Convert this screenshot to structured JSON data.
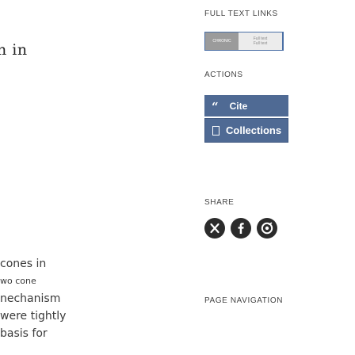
{
  "article": {
    "heading_fragment": "n in",
    "lines": [
      {
        "text": "cones in",
        "small": false
      },
      {
        "text": "wo cone",
        "small": true
      },
      {
        "text": "nechanism",
        "small": false
      },
      {
        "text": "were tightly",
        "small": false
      },
      {
        "text": "basis for",
        "small": false
      }
    ]
  },
  "sidebar": {
    "full_text_links": {
      "label": "FULL TEXT LINKS",
      "badge_left": "CHRONIC",
      "badge_right_line1": "Full text",
      "badge_right_line2": "Full text"
    },
    "actions": {
      "label": "ACTIONS",
      "cite_label": "Cite",
      "collections_label": "Collections"
    },
    "share": {
      "label": "SHARE",
      "buttons": [
        {
          "icon": "x-twitter-icon"
        },
        {
          "icon": "facebook-icon"
        },
        {
          "icon": "reddit-icon"
        }
      ]
    },
    "page_navigation": {
      "label": "PAGE NAVIGATION"
    }
  },
  "colors": {
    "accent": "#4f6a94",
    "badge_border": "#4a6fa5",
    "share_bg": "#2b2b2b"
  }
}
